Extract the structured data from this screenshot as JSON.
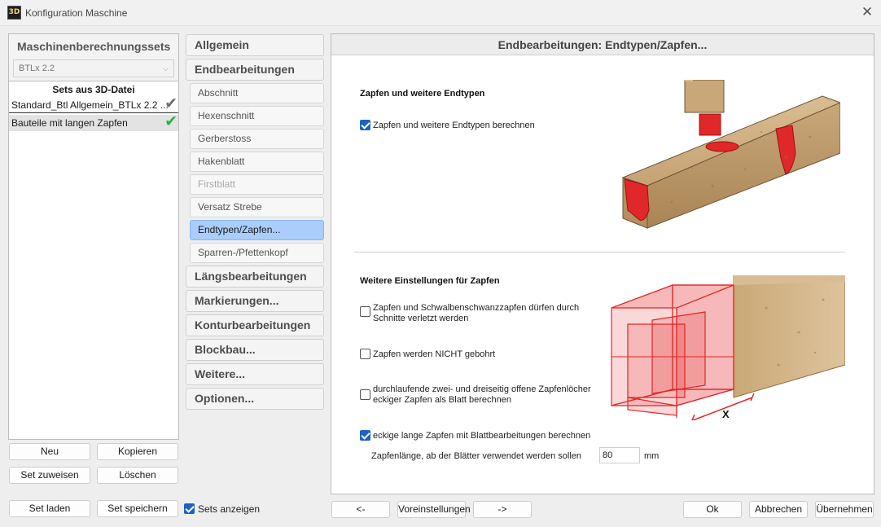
{
  "window": {
    "title": "Konfiguration Maschine",
    "app_icon_text": "3D",
    "close_glyph": "✕"
  },
  "sets_panel": {
    "header": "Maschinenberechnungssets",
    "format_select": {
      "value": "BTLx 2.2",
      "chevron": "⌵"
    },
    "group_header": "Sets aus 3D-Datei",
    "items": [
      {
        "label": "Standard_Btl Allgemein_BTLx 2.2 ...",
        "check": "✔",
        "check_color": "#6e6e6e"
      },
      {
        "label": "Bauteile mit langen Zapfen",
        "check": "✔",
        "check_color": "#2db24a"
      }
    ],
    "buttons": {
      "new": "Neu",
      "copy": "Kopieren",
      "assign": "Set zuweisen",
      "delete": "Löschen",
      "load": "Set laden",
      "save": "Set speichern"
    },
    "show_sets": {
      "label": "Sets anzeigen",
      "checked": true
    }
  },
  "nav": {
    "allgemein": "Allgemein",
    "endbearbeitungen": "Endbearbeitungen",
    "sub_items": [
      {
        "label": "Abschnitt",
        "state": "normal"
      },
      {
        "label": "Hexenschnitt",
        "state": "normal"
      },
      {
        "label": "Gerberstoss",
        "state": "normal"
      },
      {
        "label": "Hakenblatt",
        "state": "normal"
      },
      {
        "label": "Firstblatt",
        "state": "disabled"
      },
      {
        "label": "Versatz Strebe",
        "state": "normal"
      },
      {
        "label": "Endtypen/Zapfen...",
        "state": "active"
      },
      {
        "label": "Sparren-/Pfettenkopf",
        "state": "normal"
      }
    ],
    "laengsbearbeitungen": "Längsbearbeitungen",
    "markierungen": "Markierungen...",
    "konturbearbeitungen": "Konturbearbeitungen",
    "blockbau": "Blockbau...",
    "weitere": "Weitere...",
    "optionen": "Optionen..."
  },
  "content": {
    "header": "Endbearbeitungen: Endtypen/Zapfen...",
    "section1": {
      "title": "Zapfen und weitere Endtypen",
      "option": {
        "label": "Zapfen und weitere Endtypen berechnen",
        "checked": true
      }
    },
    "section2": {
      "title": "Weitere Einstellungen für Zapfen",
      "options": [
        {
          "label_line1": "Zapfen und Schwalbenschwanzzapfen dürfen durch",
          "label_line2": "Schnitte verletzt werden",
          "checked": false
        },
        {
          "label": "Zapfen werden NICHT gebohrt",
          "checked": false
        },
        {
          "label_line1": "durchlaufende zwei- und dreiseitig offene Zapfenlöcher",
          "label_line2": "eckiger Zapfen als Blatt berechnen",
          "checked": false
        },
        {
          "label": "eckige lange Zapfen mit Blattbearbeitungen berechnen",
          "checked": true
        }
      ],
      "length_field": {
        "label": "Zapfenlänge, ab der Blätter verwendet werden sollen",
        "value": "80",
        "unit": "mm"
      },
      "diagram_label": "X"
    }
  },
  "footer": {
    "prev": "<-",
    "defaults": "Voreinstellungen",
    "next": "->",
    "ok": "Ok",
    "cancel": "Abbrechen",
    "apply": "Übernehmen"
  },
  "colors": {
    "accent_blue": "#1a63c4",
    "active_nav": "#a9cdfc",
    "tenon_red": "#e0282a",
    "wood": "#c9a779",
    "check_green": "#2db24a"
  }
}
